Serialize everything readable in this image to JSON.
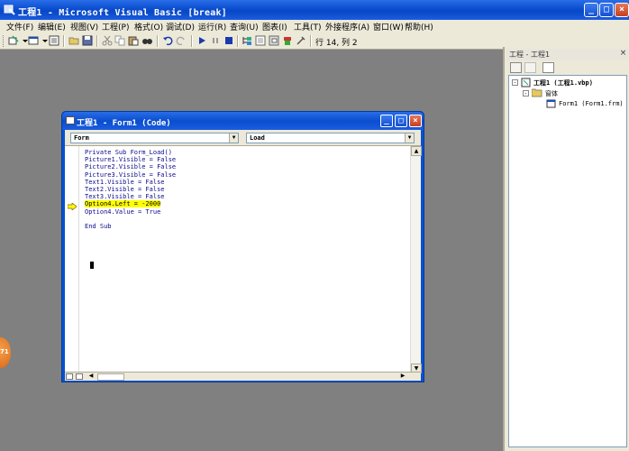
{
  "window": {
    "title": "工程1 - Microsoft Visual Basic [break]"
  },
  "menu": [
    "文件(F)",
    "编辑(E)",
    "视图(V)",
    "工程(P)",
    "格式(O)",
    "调试(D)",
    "运行(R)",
    "查询(U)",
    "图表(I)",
    "工具(T)",
    "外接程序(A)",
    "窗口(W)",
    "帮助(H)"
  ],
  "toolbar": {
    "cursor_position": "行 14, 列 2"
  },
  "badge": {
    "text": "71"
  },
  "code_window": {
    "title": "工程1 - Form1 (Code)",
    "object_combo": "Form",
    "procedure_combo": "Load",
    "lines": [
      "Private Sub Form_Load()",
      "Picture1.Visible = False",
      "Picture2.Visible = False",
      "Picture3.Visible = False",
      "Text1.Visible = False",
      "Text2.Visible = False",
      "Text3.Visible = False",
      "Option4.Left = -2000",
      "Option4.Value = True",
      "",
      "End Sub"
    ],
    "highlighted_line_index": 7
  },
  "project": {
    "title": "工程 - 工程1",
    "root": "工程1 (工程1.vbp)",
    "folder": "窗体",
    "item": "Form1 (Form1.frm)"
  },
  "colors": {
    "titlebar": "#0a4ecf",
    "highlight": "#ffff00",
    "mdi_background": "#808080"
  }
}
